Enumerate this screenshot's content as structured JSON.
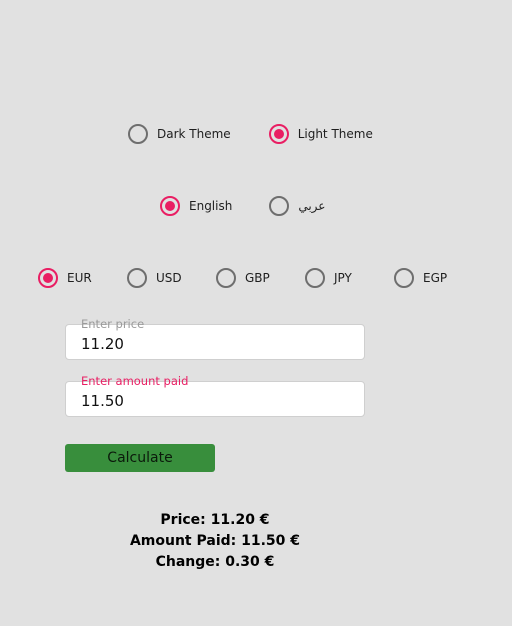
{
  "theme": {
    "options": [
      {
        "label": "Dark Theme",
        "checked": false
      },
      {
        "label": "Light Theme",
        "checked": true
      }
    ]
  },
  "language": {
    "options": [
      {
        "label": "English",
        "checked": true
      },
      {
        "label": "عربي",
        "checked": false
      }
    ]
  },
  "currency": {
    "options": [
      {
        "label": "EUR",
        "checked": true
      },
      {
        "label": "USD",
        "checked": false
      },
      {
        "label": "GBP",
        "checked": false
      },
      {
        "label": "JPY",
        "checked": false
      },
      {
        "label": "EGP",
        "checked": false
      }
    ]
  },
  "form": {
    "price": {
      "label": "Enter price",
      "value": "11.20"
    },
    "amount_paid": {
      "label": "Enter amount paid",
      "value": "11.50"
    },
    "calculate_label": "Calculate"
  },
  "results": {
    "price": "Price: 11.20 €",
    "amount_paid": "Amount Paid: 11.50 €",
    "change": "Change: 0.30 €"
  },
  "colors": {
    "background": "#e1e1e1",
    "accent": "#e91e63",
    "button": "#388e3c",
    "radio_unchecked": "#6e6e6e"
  }
}
